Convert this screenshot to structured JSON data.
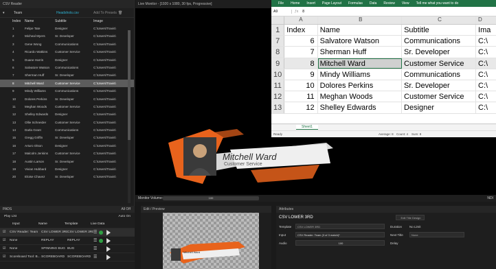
{
  "csv_reader": {
    "panel_title": "CSV Reader",
    "source_name": "Team",
    "link_text": "Headshots.csv",
    "add_to_presets": "Add To Presets",
    "columns": [
      "Index",
      "Name",
      "Subtitle",
      "Image"
    ],
    "rows": [
      [
        "1",
        "Felipe Tate",
        "Designer",
        "C:\\Users\\Travis\\"
      ],
      [
        "2",
        "Micheal Myers",
        "Sr. Developer",
        "C:\\Users\\Travis\\"
      ],
      [
        "3",
        "Gene Wong",
        "Communications",
        "C:\\Users\\Travis\\"
      ],
      [
        "4",
        "Ricardo Watkins",
        "Customer Service",
        "C:\\Users\\Travis\\"
      ],
      [
        "5",
        "Duane Harris",
        "Designer",
        "C:\\Users\\Travis\\"
      ],
      [
        "6",
        "Salvatore Watson",
        "Communications",
        "C:\\Users\\Travis\\"
      ],
      [
        "7",
        "Sherman Huff",
        "Sr. Developer",
        "C:\\Users\\Travis\\"
      ],
      [
        "8",
        "Mitchell Ward",
        "Customer Service",
        "C:\\Users\\Travis\\"
      ],
      [
        "9",
        "Mindy Williams",
        "Communications",
        "C:\\Users\\Travis\\"
      ],
      [
        "10",
        "Dolores Perkins",
        "Sr. Developer",
        "C:\\Users\\Travis\\"
      ],
      [
        "11",
        "Meghan Woods",
        "Customer Service",
        "C:\\Users\\Travis\\"
      ],
      [
        "12",
        "Shelley Edwards",
        "Designer",
        "C:\\Users\\Travis\\"
      ],
      [
        "13",
        "Ollie Schneider",
        "Customer Service",
        "C:\\Users\\Travis\\"
      ],
      [
        "14",
        "Darla Grant",
        "Communications",
        "C:\\Users\\Travis\\"
      ],
      [
        "15",
        "Gregg Griffin",
        "Sr. Developer",
        "C:\\Users\\Travis\\"
      ],
      [
        "16",
        "Arturo Olson",
        "Designer",
        "C:\\Users\\Travis\\"
      ],
      [
        "17",
        "Malcolm Jenkins",
        "Customer Service",
        "C:\\Users\\Travis\\"
      ],
      [
        "18",
        "Austin Larson",
        "Sr. Developer",
        "C:\\Users\\Travis\\"
      ],
      [
        "19",
        "Vivian Hubbard",
        "Designer",
        "C:\\Users\\Travis\\"
      ],
      [
        "20",
        "Eloise Chavez",
        "Sr. Developer",
        "C:\\Users\\Travis\\"
      ]
    ],
    "selected_row": 7
  },
  "monitor": {
    "title": "Live Monitor - [1920 x 1080, 30 fps, Progressive]",
    "volume_label": "Monitor Volume:",
    "volume_value": "100",
    "ndi_label": "NDI"
  },
  "lower_third": {
    "name": "Mitchell Ward",
    "role": "Customer Service"
  },
  "excel": {
    "ribbon_tabs": [
      "File",
      "Home",
      "Insert",
      "Page Layout",
      "Formulas",
      "Data",
      "Review",
      "View",
      "Tell me what you want to do"
    ],
    "name_box": "A9",
    "formula_value": "8",
    "column_headers": [
      "A",
      "B",
      "C",
      "D"
    ],
    "rows": [
      {
        "num": "1",
        "a": "Index",
        "b": "Name",
        "c": "Subtitle",
        "d": "Ima"
      },
      {
        "num": "7",
        "a": "6",
        "b": "Salvatore Watson",
        "c": "Communications",
        "d": "C:\\"
      },
      {
        "num": "8",
        "a": "7",
        "b": "Sherman Huff",
        "c": "Sr. Developer",
        "d": "C:\\"
      },
      {
        "num": "9",
        "a": "8",
        "b": "Mitchell Ward",
        "c": "Customer Service",
        "d": "C:\\"
      },
      {
        "num": "10",
        "a": "9",
        "b": "Mindy Williams",
        "c": "Communications",
        "d": "C:\\"
      },
      {
        "num": "11",
        "a": "10",
        "b": "Dolores Perkins",
        "c": "Sr. Developer",
        "d": "C:\\"
      },
      {
        "num": "12",
        "a": "11",
        "b": "Meghan Woods",
        "c": "Customer Service",
        "d": "C:\\"
      },
      {
        "num": "13",
        "a": "12",
        "b": "Shelley Edwards",
        "c": "Designer",
        "d": "C:\\"
      }
    ],
    "selected_row": 3,
    "sheet_tab": "Sheet1",
    "status_ready": "Ready",
    "status_average": "Average: 8",
    "status_count": "Count: 4",
    "status_sum": "Sum: 8"
  },
  "pads": {
    "title": "PADS",
    "all_off": "All Off",
    "playlist": "Play List",
    "auto_on": "Auto On",
    "columns": [
      "Input",
      "Name",
      "Template",
      "Live Data"
    ],
    "rows": [
      {
        "input": "CSV Reader: Team",
        "name": "CSV LOWER 3RD",
        "template": "CSV LOWER 3RD"
      },
      {
        "input": "None",
        "name": "REPLAY",
        "template": "REPLAY"
      },
      {
        "input": "None",
        "name": "SPINNING BUG",
        "template": "BUG"
      },
      {
        "input": "Scoreboard Tool: B...",
        "name": "SCOREBOARD",
        "template": "SCOREBOARD"
      }
    ]
  },
  "edit_preview": {
    "title": "Edit / Preview",
    "thumb_name": "Mitchell Ward"
  },
  "attributes": {
    "title": "Attributes",
    "name": "CSV LOWER 3RD",
    "edit_title_design": "Edit Title Design",
    "template_label": "Template",
    "template_value": "CSV LOWER 3RD",
    "duration_label": "Duration",
    "no_limit": "No Limit",
    "input_label": "Input",
    "input_value": "CSV Reader: Team (3 of 3 match)*",
    "next_title_label": "Next Title",
    "next_title_value": "None",
    "audio_label": "Audio",
    "audio_value": "100",
    "delay_label": "Delay"
  },
  "colors": {
    "excel_green": "#217346",
    "accent_orange": "#e8631c",
    "live_green": "#2ea043"
  }
}
